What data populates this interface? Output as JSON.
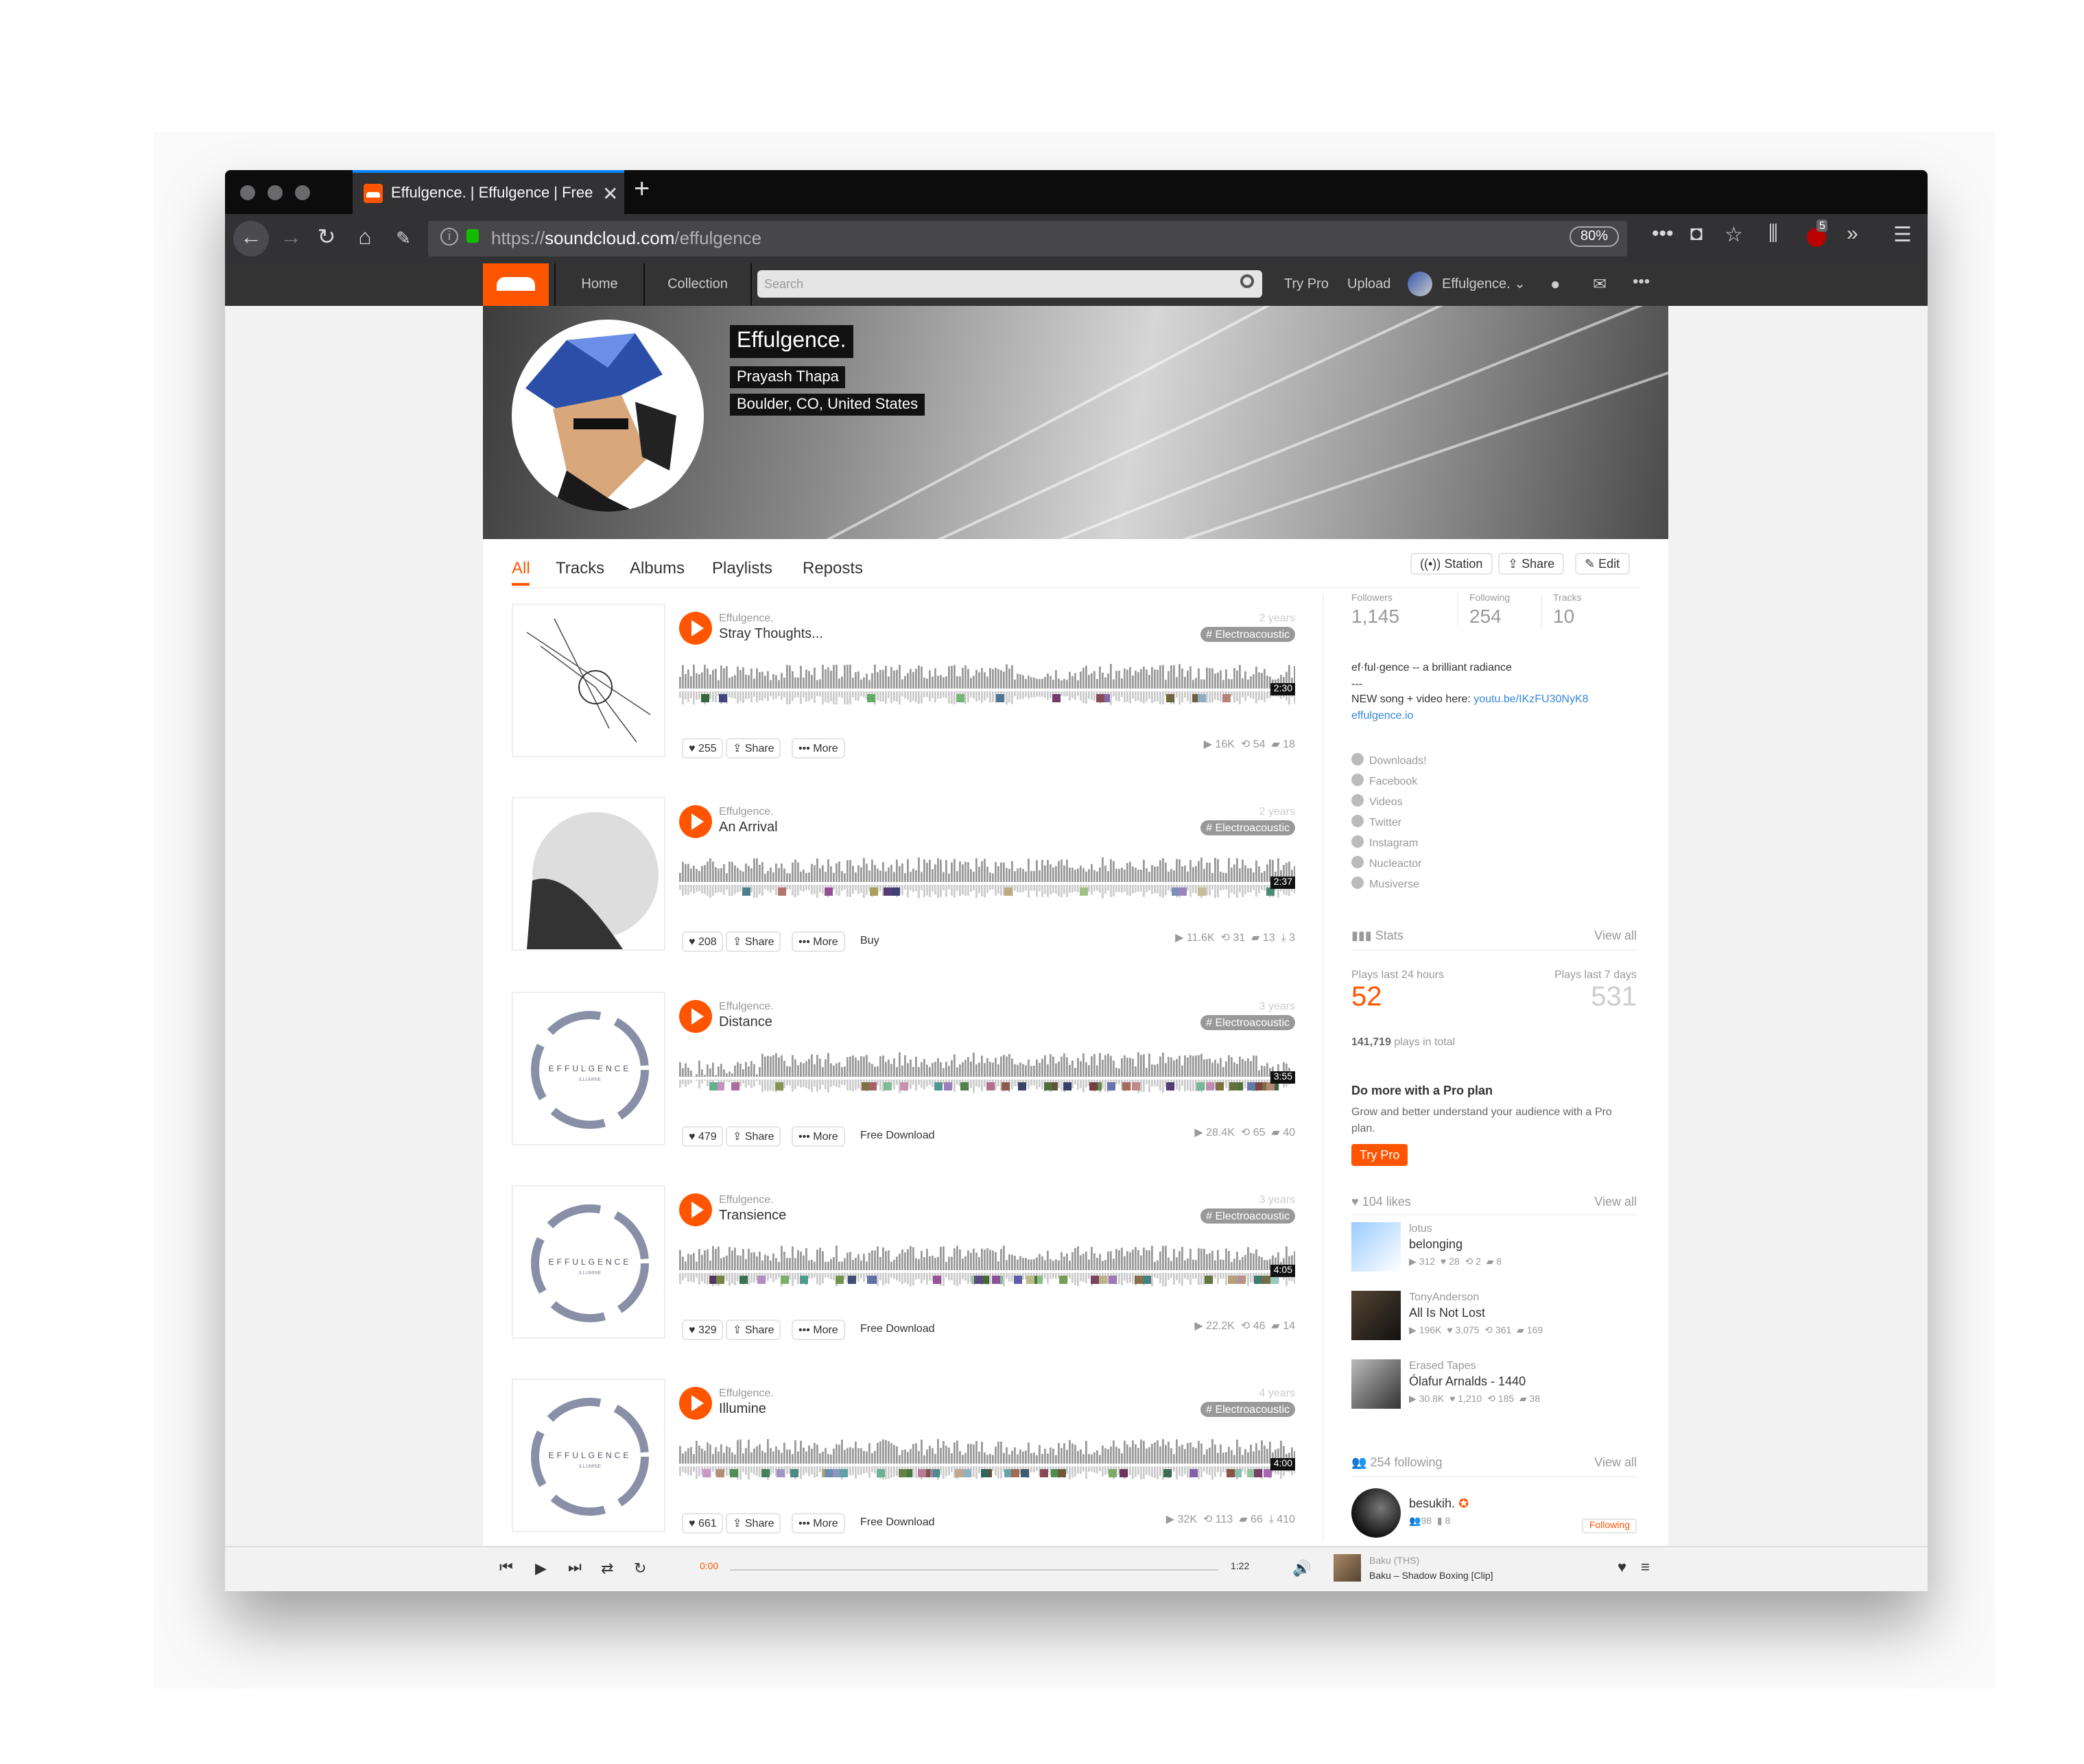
{
  "browser": {
    "tab_title": "Effulgence. | Effulgence | Free Listening on SoundCloud",
    "url_prefix": "https://",
    "url_host": "soundcloud.com",
    "url_path": "/effulgence",
    "zoom": "80%",
    "addon_badge": "5"
  },
  "sc_header": {
    "home": "Home",
    "collection": "Collection",
    "search_placeholder": "Search",
    "try_pro": "Try Pro",
    "upload": "Upload",
    "user": "Effulgence."
  },
  "profile": {
    "display_name": "Effulgence.",
    "real_name": "Prayash Thapa",
    "location": "Boulder, CO, United States"
  },
  "tabs": [
    "All",
    "Tracks",
    "Albums",
    "Playlists",
    "Reposts"
  ],
  "profile_buttons": {
    "station": "Station",
    "share": "Share",
    "edit": "Edit"
  },
  "track_actions": {
    "share": "Share",
    "more": "More"
  },
  "tracks": [
    {
      "user": "Effulgence.",
      "title": "Stray Thoughts...",
      "age": "2 years",
      "tag": "# Electroacoustic",
      "duration": "2:30",
      "likes": "255",
      "extra": "",
      "plays": "16K",
      "reposts": "54",
      "comments": "18",
      "downloads": ""
    },
    {
      "user": "Effulgence.",
      "title": "An Arrival",
      "age": "2 years",
      "tag": "# Electroacoustic",
      "duration": "2:37",
      "likes": "208",
      "extra": "Buy",
      "plays": "11.6K",
      "reposts": "31",
      "comments": "13",
      "downloads": "3"
    },
    {
      "user": "Effulgence.",
      "title": "Distance",
      "age": "3 years",
      "tag": "# Electroacoustic",
      "duration": "3:55",
      "likes": "479",
      "extra": "Free Download",
      "plays": "28.4K",
      "reposts": "65",
      "comments": "40",
      "downloads": ""
    },
    {
      "user": "Effulgence.",
      "title": "Transience",
      "age": "3 years",
      "tag": "# Electroacoustic",
      "duration": "4:05",
      "likes": "329",
      "extra": "Free Download",
      "plays": "22.2K",
      "reposts": "46",
      "comments": "14",
      "downloads": ""
    },
    {
      "user": "Effulgence.",
      "title": "Illumine",
      "age": "4 years",
      "tag": "# Electroacoustic",
      "duration": "4:00",
      "likes": "661",
      "extra": "Free Download",
      "plays": "32K",
      "reposts": "113",
      "comments": "66",
      "downloads": "410"
    }
  ],
  "art_text": {
    "brand": "EFFULGENCE",
    "sub": "ILLUMINE"
  },
  "sidebar": {
    "followers_label": "Followers",
    "followers": "1,145",
    "following_label": "Following",
    "following": "254",
    "tracks_label": "Tracks",
    "tracks": "10",
    "bio_line1": "ef·ful·gence -- a brilliant radiance",
    "bio_line2": "---",
    "bio_line3": "NEW song + video here: ",
    "bio_link1": "youtu.be/IKzFU30NyK8",
    "bio_link2": "effulgence.io",
    "links": [
      "Downloads!",
      "Facebook",
      "Videos",
      "Twitter",
      "Instagram",
      "Nucleactor",
      "Musiverse"
    ],
    "stats_title": "Stats",
    "view_all": "View all",
    "plays24_label": "Plays last 24 hours",
    "plays24": "52",
    "plays7_label": "Plays last 7 days",
    "plays7": "531",
    "plays_total": "141,719",
    "plays_total_suffix": " plays in total",
    "pro_title": "Do more with a Pro plan",
    "pro_text": "Grow and better understand your audience with a Pro plan.",
    "pro_button": "Try Pro",
    "likes_title": "104 likes",
    "likes": [
      {
        "user": "lotus",
        "name": "belonging",
        "plays": "312",
        "likes": "28",
        "reposts": "2",
        "comments": "8"
      },
      {
        "user": "TonyAnderson",
        "name": "All Is Not Lost",
        "plays": "196K",
        "likes": "3,075",
        "reposts": "361",
        "comments": "169"
      },
      {
        "user": "Erased Tapes",
        "name": "Ólafur Arnalds - 1440",
        "plays": "30.8K",
        "likes": "1,210",
        "reposts": "185",
        "comments": "38"
      }
    ],
    "following_title": "254 following",
    "follow_user": "besukih.",
    "follow_followers": "98",
    "follow_tracks": "8",
    "following_btn": "Following"
  },
  "player": {
    "current": "0:00",
    "total": "1:22",
    "artist": "Baku (THS)",
    "track": "Baku – Shadow Boxing [Clip]"
  },
  "colors": {
    "accent": "#ff5500",
    "browser_chrome": "#0c0c0d",
    "sc_header": "#333333"
  }
}
